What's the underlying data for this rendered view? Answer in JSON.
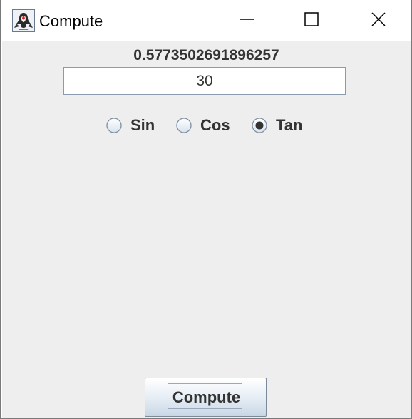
{
  "window": {
    "title": "Compute",
    "controls": {
      "minimize": "minimize-icon",
      "maximize": "maximize-icon",
      "close": "close-icon"
    }
  },
  "result": {
    "value": "0.5773502691896257"
  },
  "input": {
    "value": "30"
  },
  "functions": {
    "options": [
      {
        "label": "Sin",
        "selected": false
      },
      {
        "label": "Cos",
        "selected": false
      },
      {
        "label": "Tan",
        "selected": true
      }
    ]
  },
  "compute_button": {
    "label": "Compute"
  },
  "colors": {
    "panel_background": "#eeeeee",
    "text": "#333333",
    "field_border": "#8a9bb0"
  }
}
